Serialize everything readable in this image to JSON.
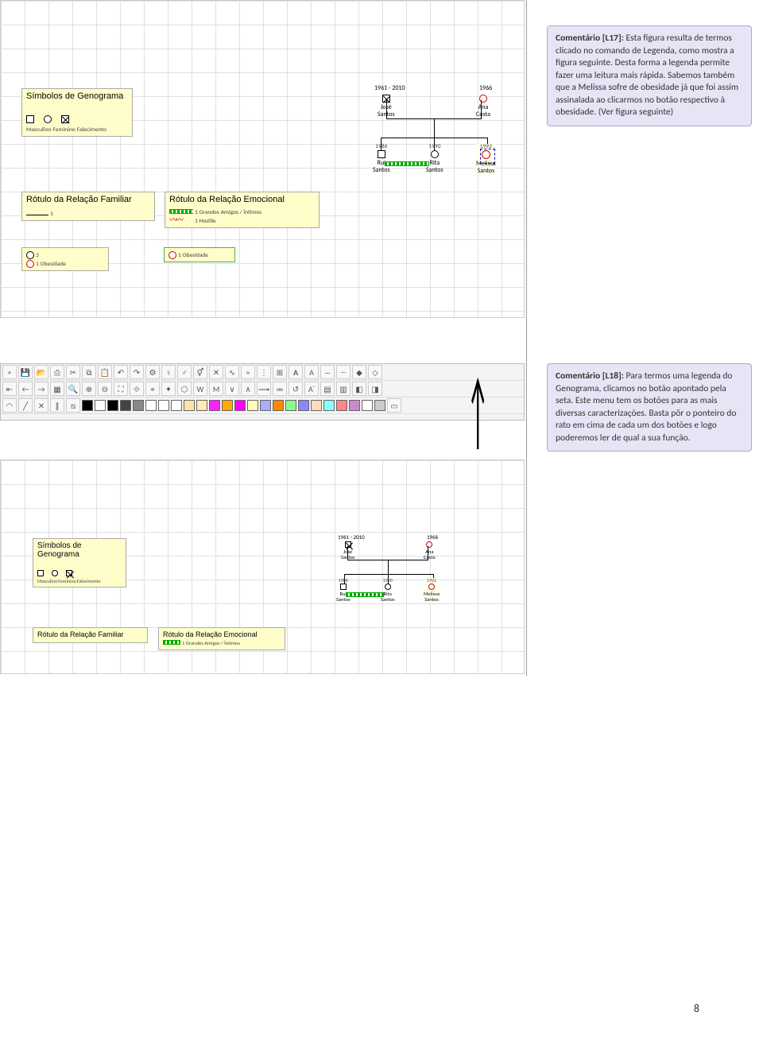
{
  "page_number": "8",
  "comments": [
    {
      "label": "Comentário [L17]:",
      "text": "Esta figura resulta de termos clicado no comando de Legenda, como mostra a figura seguinte. Desta forma a legenda permite fazer uma leitura mais rápida. Sabemos também que a Melissa sofre de obesidade já que foi assim assinalada ao clicarmos no botão respectivo à obesidade. (Ver figura seguinte)"
    },
    {
      "label": "Comentário [L18]:",
      "text": "Para termos uma legenda do Genograma, clicamos no botão apontado pela seta. Este menu tem os botões para as mais diversas caracterizações. Basta pôr o ponteiro do rato em cima de cada um dos botões e logo poderemos ler de qual a sua função."
    }
  ],
  "legend_cards": {
    "simbolos": {
      "title": "Símbolos de Genograma",
      "items": [
        "Masculino",
        "Feminino",
        "Falecimento"
      ]
    },
    "rel_fam": {
      "title": "Rótulo da Relação Familiar",
      "item": "1"
    },
    "rel_emo": {
      "title": "Rótulo da Relação Emocional",
      "green": "1 Grandes Amigos / Íntimos",
      "red": "1 Hostile"
    },
    "misc_left": {
      "a": "3",
      "b": "1 Obesidade"
    },
    "misc_right": {
      "a": "1 Obesidade"
    }
  },
  "genogram": {
    "date1": "1961 - 2010",
    "date2": "1966",
    "p1": {
      "name": "José",
      "surname": "Santos"
    },
    "p2": {
      "name": "Ana",
      "surname": "Costa"
    },
    "c1": {
      "year": "1986",
      "name": "Rui",
      "surname": "Santos"
    },
    "c2": {
      "year": "1990",
      "name": "Rita",
      "surname": "Santos"
    },
    "c3": {
      "year": "1992",
      "name": "Melissa",
      "surname": "Santos"
    }
  },
  "toolbar_colors": [
    "#fff",
    "#fff",
    "#f7e7a3",
    "#ffecb0",
    "#f2f",
    "#fa0",
    "#f0f",
    "#ffb",
    "#aaf",
    "#f80",
    "#8f8",
    "#88f",
    "#fdb",
    "#8ff",
    "#f88",
    "#c8c",
    "#fff",
    "#ccc"
  ]
}
